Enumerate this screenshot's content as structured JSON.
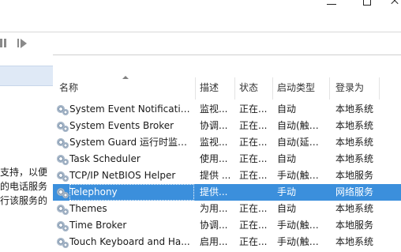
{
  "toolbar": {
    "pause_icon": "pause-icon",
    "restart_icon": "restart-icon"
  },
  "left_pane": {
    "description_lines": [
      "支持，以便",
      "的电话服务",
      "行该服务的"
    ]
  },
  "columns": [
    {
      "key": "name",
      "label": "名称"
    },
    {
      "key": "description",
      "label": "描述"
    },
    {
      "key": "status",
      "label": "状态"
    },
    {
      "key": "startup",
      "label": "启动类型"
    },
    {
      "key": "logon",
      "label": "登录为"
    }
  ],
  "rows": [
    {
      "name": "System Event Notification...",
      "description": "监视...",
      "status": "正在...",
      "startup": "自动",
      "logon": "本地系统",
      "selected": false
    },
    {
      "name": "System Events Broker",
      "description": "协调...",
      "status": "正在...",
      "startup": "自动(触发...",
      "logon": "本地系统",
      "selected": false
    },
    {
      "name": "System Guard 运行时监视...",
      "description": "监视...",
      "status": "正在...",
      "startup": "自动(延迟...",
      "logon": "本地系统",
      "selected": false
    },
    {
      "name": "Task Scheduler",
      "description": "使用...",
      "status": "正在...",
      "startup": "自动",
      "logon": "本地系统",
      "selected": false
    },
    {
      "name": "TCP/IP NetBIOS Helper",
      "description": "提供 ...",
      "status": "正在...",
      "startup": "手动(触发...",
      "logon": "本地服务",
      "selected": false
    },
    {
      "name": "Telephony",
      "description": "提供...",
      "status": "",
      "startup": "手动",
      "logon": "网络服务",
      "selected": true
    },
    {
      "name": "Themes",
      "description": "为用...",
      "status": "正在...",
      "startup": "自动",
      "logon": "本地系统",
      "selected": false
    },
    {
      "name": "Time Broker",
      "description": "协调...",
      "status": "正在...",
      "startup": "手动(触发...",
      "logon": "本地服务",
      "selected": false
    },
    {
      "name": "Touch Keyboard and Ha...",
      "description": "启用...",
      "status": "正在...",
      "startup": "手动(触发...",
      "logon": "本地系统",
      "selected": false
    }
  ]
}
